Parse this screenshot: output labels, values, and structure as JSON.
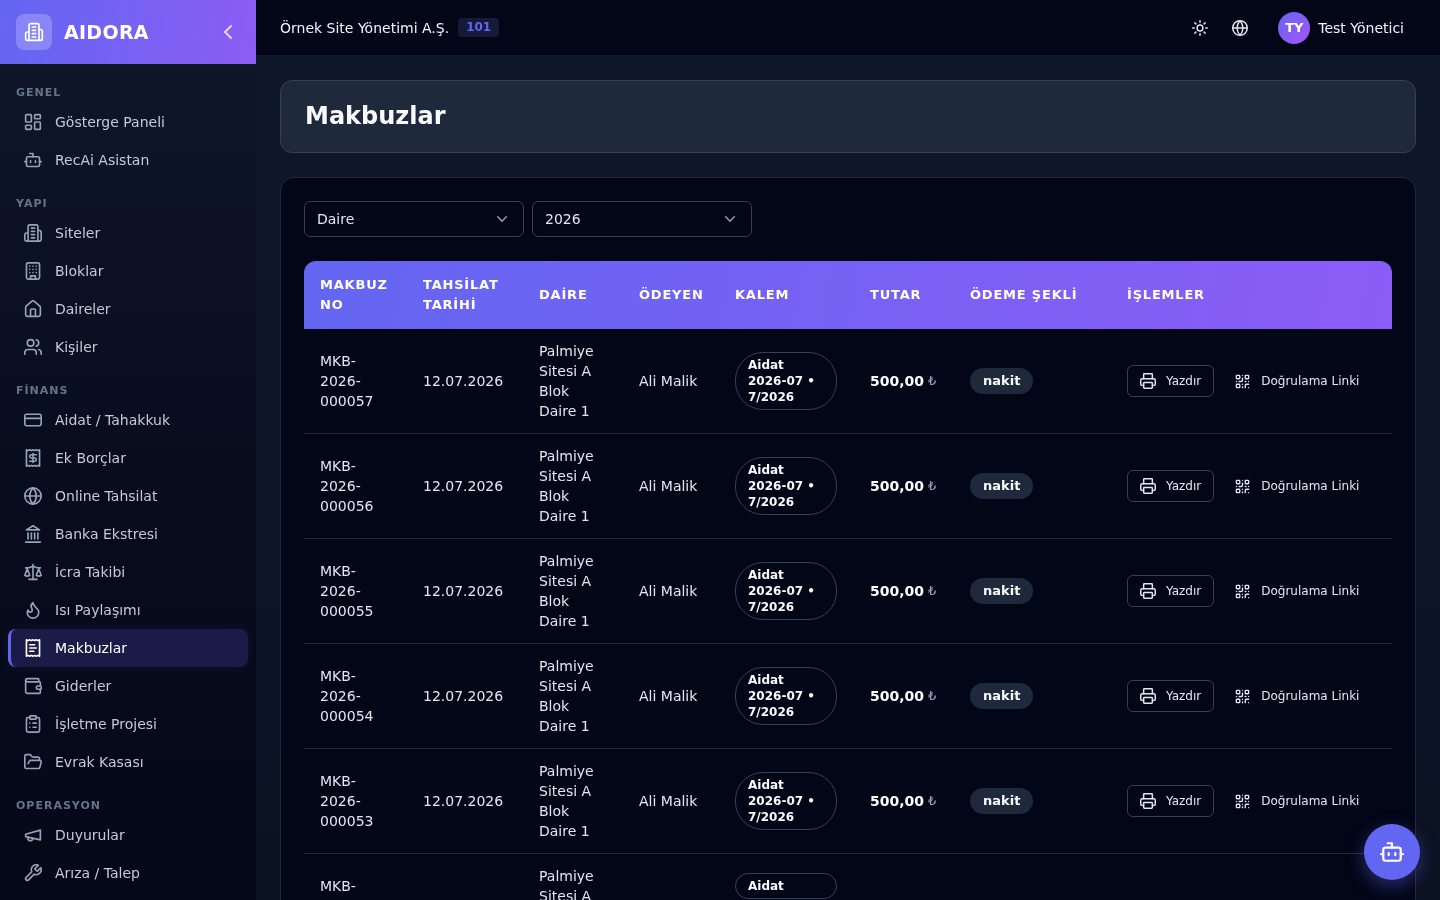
{
  "sidebar": {
    "brand": "AIDORA",
    "sections": [
      {
        "label": "GENEL",
        "items": [
          {
            "label": "Gösterge Paneli",
            "selected": false
          },
          {
            "label": "RecAi Asistan",
            "selected": false
          }
        ]
      },
      {
        "label": "YAPI",
        "items": [
          {
            "label": "Siteler",
            "selected": false
          },
          {
            "label": "Bloklar",
            "selected": false
          },
          {
            "label": "Daireler",
            "selected": false
          },
          {
            "label": "Kişiler",
            "selected": false
          }
        ]
      },
      {
        "label": "FİNANS",
        "items": [
          {
            "label": "Aidat / Tahakkuk",
            "selected": false
          },
          {
            "label": "Ek Borçlar",
            "selected": false
          },
          {
            "label": "Online Tahsilat",
            "selected": false
          },
          {
            "label": "Banka Ekstresi",
            "selected": false
          },
          {
            "label": "İcra Takibi",
            "selected": false
          },
          {
            "label": "Isı Paylaşımı",
            "selected": false
          },
          {
            "label": "Makbuzlar",
            "selected": true
          },
          {
            "label": "Giderler",
            "selected": false
          },
          {
            "label": "İşletme Projesi",
            "selected": false
          },
          {
            "label": "Evrak Kasası",
            "selected": false
          }
        ]
      },
      {
        "label": "OPERASYON",
        "items": [
          {
            "label": "Duyurular",
            "selected": false
          },
          {
            "label": "Arıza / Talep",
            "selected": false
          }
        ]
      }
    ]
  },
  "top_bar": {
    "organization": "Örnek Site Yönetimi A.Ş.",
    "organization_badge": "101",
    "user": {
      "initials": "TY",
      "name": "Test Yönetici"
    }
  },
  "page": {
    "title": "Makbuzlar"
  },
  "filters": [
    {
      "value": "Daire"
    },
    {
      "value": "2026"
    }
  ],
  "table": {
    "columns": [
      "MAKBUZ NO",
      "TAHSİLAT TARİHİ",
      "DAİRE",
      "ÖDEYEN",
      "KALEM",
      "TUTAR",
      "ÖDEME ŞEKLİ",
      "İŞLEMLER"
    ],
    "rows": [
      {
        "receipt_no": "MKB-2026-000057",
        "date": "12.07.2026",
        "apartment": "Palmiye Sitesi A Blok Daire 1",
        "payer": "Ali Malik",
        "item": "Aidat 2026-07 • 7/2026",
        "amount": "500,00",
        "currency": "₺",
        "method": "nakit",
        "actions": [
          {
            "kind": "print",
            "label": "Yazdır"
          },
          {
            "kind": "verify",
            "label": "Doğrulama Linki"
          }
        ]
      },
      {
        "receipt_no": "MKB-2026-000056",
        "date": "12.07.2026",
        "apartment": "Palmiye Sitesi A Blok Daire 1",
        "payer": "Ali Malik",
        "item": "Aidat 2026-07 • 7/2026",
        "amount": "500,00",
        "currency": "₺",
        "method": "nakit",
        "actions": [
          {
            "kind": "print",
            "label": "Yazdır"
          },
          {
            "kind": "verify",
            "label": "Doğrulama Linki"
          }
        ]
      },
      {
        "receipt_no": "MKB-2026-000055",
        "date": "12.07.2026",
        "apartment": "Palmiye Sitesi A Blok Daire 1",
        "payer": "Ali Malik",
        "item": "Aidat 2026-07 • 7/2026",
        "amount": "500,00",
        "currency": "₺",
        "method": "nakit",
        "actions": [
          {
            "kind": "print",
            "label": "Yazdır"
          },
          {
            "kind": "verify",
            "label": "Doğrulama Linki"
          }
        ]
      },
      {
        "receipt_no": "MKB-2026-000054",
        "date": "12.07.2026",
        "apartment": "Palmiye Sitesi A Blok Daire 1",
        "payer": "Ali Malik",
        "item": "Aidat 2026-07 • 7/2026",
        "amount": "500,00",
        "currency": "₺",
        "method": "nakit",
        "actions": [
          {
            "kind": "print",
            "label": "Yazdır"
          },
          {
            "kind": "verify",
            "label": "Doğrulama Linki"
          }
        ]
      },
      {
        "receipt_no": "MKB-2026-000053",
        "date": "12.07.2026",
        "apartment": "Palmiye Sitesi A Blok Daire 1",
        "payer": "Ali Malik",
        "item": "Aidat 2026-07 • 7/2026",
        "amount": "500,00",
        "currency": "₺",
        "method": "nakit",
        "actions": [
          {
            "kind": "print",
            "label": "Yazdır"
          },
          {
            "kind": "verify",
            "label": "Doğrulama Linki"
          }
        ]
      },
      {
        "receipt_no": "MKB-",
        "apartment": "Palmiye Sitesi A",
        "item": "Aidat"
      }
    ]
  }
}
